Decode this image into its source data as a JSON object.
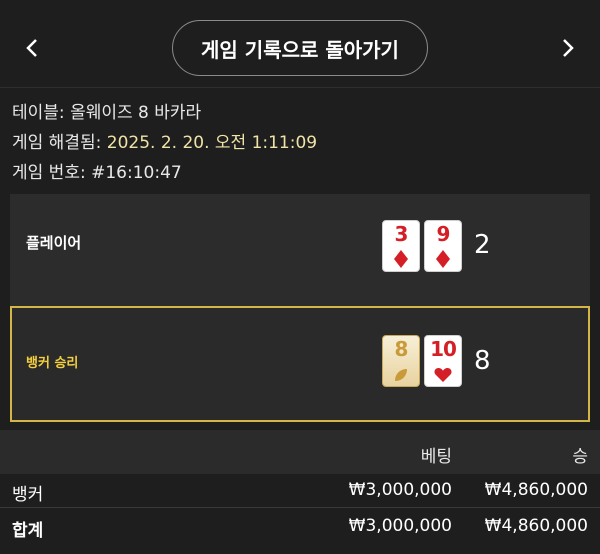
{
  "header": {
    "back_label": "게임 기록으로 돌아가기",
    "prev_icon": "chevron-left-icon",
    "next_icon": "chevron-right-icon"
  },
  "info": {
    "table_label": "테이블:",
    "table_value": "올웨이즈 8 바카라",
    "resolved_label": "게임 해결됨:",
    "resolved_value": "2025. 2. 20. 오전 1:11:09",
    "game_no_label": "게임 번호:",
    "game_no_value": "#16:10:47"
  },
  "hands": {
    "player": {
      "label": "플레이어",
      "cards": [
        {
          "rank": "3",
          "suit": "diamond"
        },
        {
          "rank": "9",
          "suit": "diamond"
        }
      ],
      "total": "2"
    },
    "banker": {
      "label": "뱅커 승리",
      "cards": [
        {
          "rank": "8",
          "suit": "special"
        },
        {
          "rank": "10",
          "suit": "heart"
        }
      ],
      "total": "8"
    }
  },
  "bets": {
    "col_bet": "베팅",
    "col_win": "승",
    "rows": [
      {
        "name": "뱅커",
        "bet": "₩3,000,000",
        "win": "₩4,860,000"
      }
    ],
    "total": {
      "name": "합계",
      "bet": "₩3,000,000",
      "win": "₩4,860,000"
    }
  },
  "colors": {
    "background": "#1e1e1e",
    "accent_gold": "#f4d03f",
    "card_red": "#d41f26"
  }
}
